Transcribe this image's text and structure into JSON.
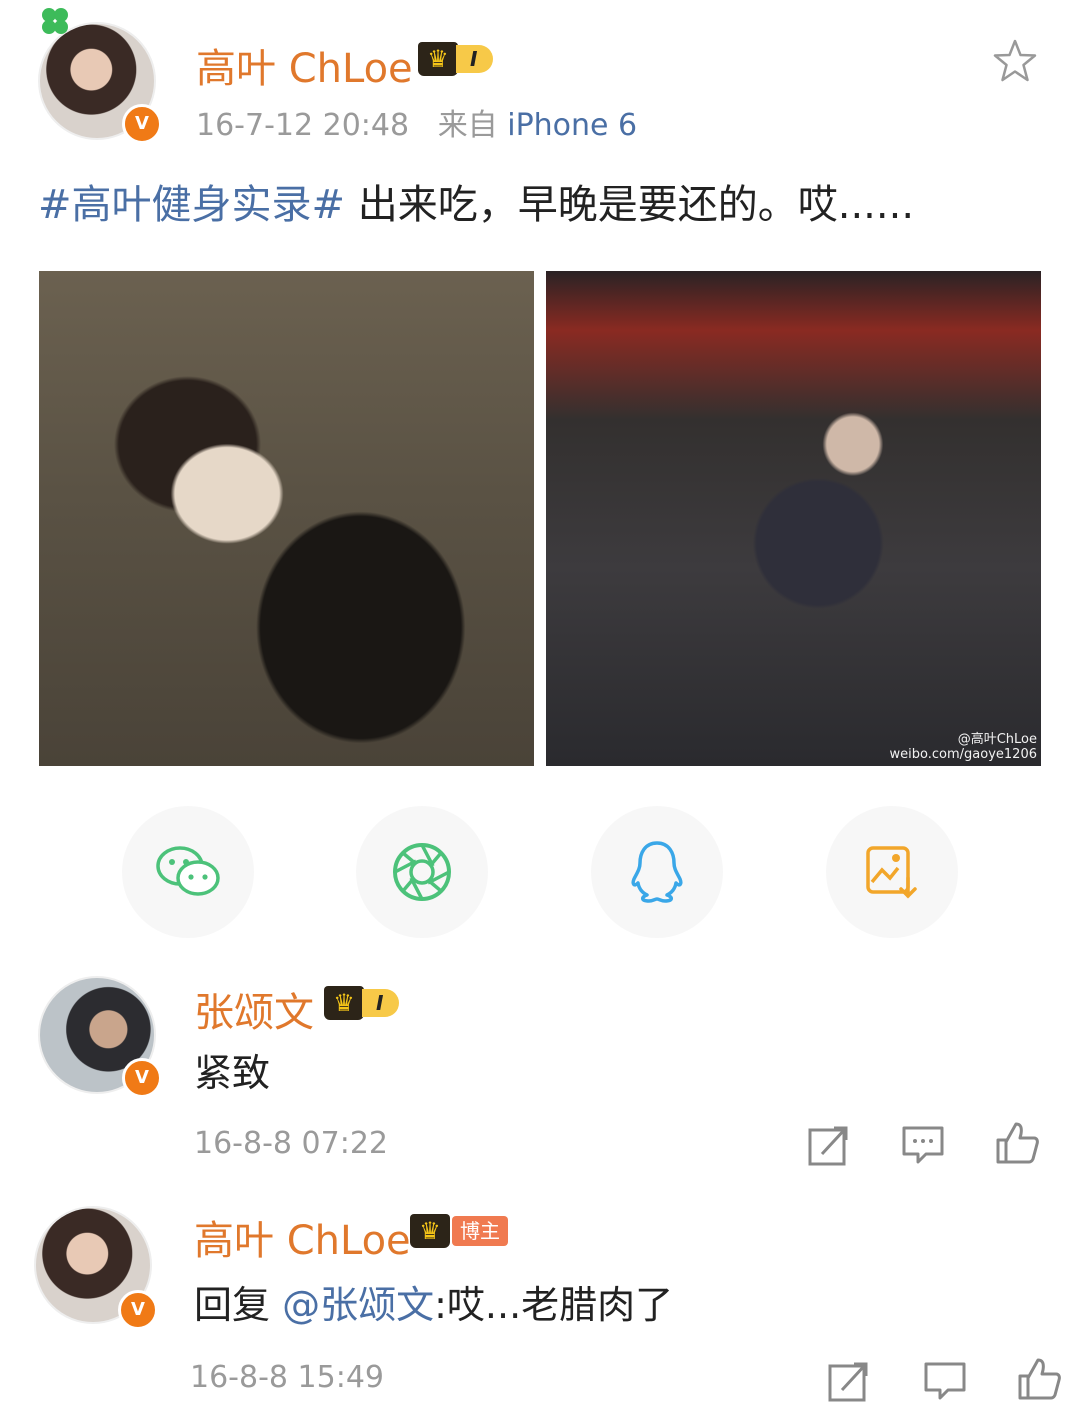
{
  "post": {
    "author": "高叶 ChLoe",
    "level": "I",
    "timestamp": "16-7-12 20:48",
    "source_prefix": "来自",
    "source_device": "iPhone 6",
    "topic": "#高叶健身实录#",
    "text": " 出来吃，早晚是要还的。哎......",
    "watermark_line1": "@高叶ChLoe",
    "watermark_line2": "weibo.com/gaoye1206"
  },
  "share": {
    "items": [
      {
        "icon": "wechat-icon",
        "color": "#4cc27a"
      },
      {
        "icon": "moments-icon",
        "color": "#4cc27a"
      },
      {
        "icon": "qq-icon",
        "color": "#3aa7e8"
      },
      {
        "icon": "save-image-icon",
        "color": "#f2a62a"
      }
    ]
  },
  "comments": [
    {
      "author": "张颂文",
      "level": "I",
      "text": "紧致",
      "timestamp": "16-8-8 07:22"
    },
    {
      "author": "高叶 ChLoe",
      "badge": "博主",
      "reply_prefix": "回复 ",
      "mention": "@张颂文",
      "text": ":哎...老腊肉了",
      "timestamp": "16-8-8 15:49"
    }
  ],
  "colors": {
    "username": "#e0782c",
    "link": "#4a6fa5",
    "meta": "#9a9a9a",
    "verified": "#f07a16"
  }
}
